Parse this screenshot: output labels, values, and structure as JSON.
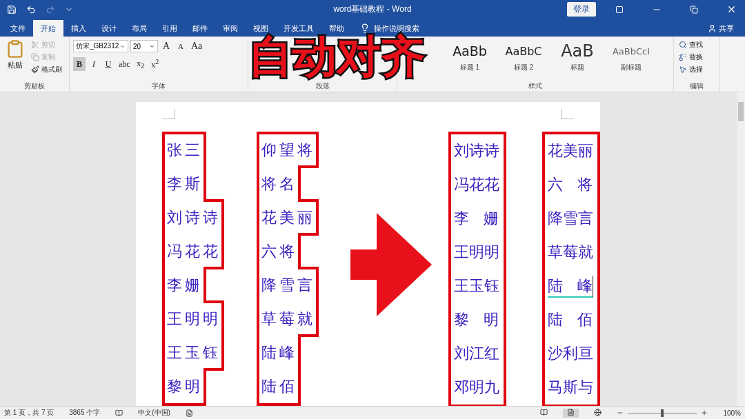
{
  "window": {
    "title": "word基础教程 - Word",
    "sign_in": "登录"
  },
  "tabs": [
    {
      "label": "文件",
      "selected": false
    },
    {
      "label": "开始",
      "selected": true
    },
    {
      "label": "插入",
      "selected": false
    },
    {
      "label": "设计",
      "selected": false
    },
    {
      "label": "布局",
      "selected": false
    },
    {
      "label": "引用",
      "selected": false
    },
    {
      "label": "邮件",
      "selected": false
    },
    {
      "label": "审阅",
      "selected": false
    },
    {
      "label": "视图",
      "selected": false
    },
    {
      "label": "开发工具",
      "selected": false
    },
    {
      "label": "帮助",
      "selected": false
    }
  ],
  "tell_me": "操作说明搜索",
  "share": "共享",
  "ribbon": {
    "clipboard": {
      "paste": "粘贴",
      "items": [
        {
          "label": "剪切",
          "disabled": true
        },
        {
          "label": "复制",
          "disabled": true
        },
        {
          "label": "格式刷",
          "disabled": false
        }
      ],
      "group": "剪贴板"
    },
    "font": {
      "name": "仿宋_GB2312",
      "size": "20",
      "row1": [
        "A",
        "A",
        "Aa"
      ],
      "row2": [
        "B",
        "I",
        "U",
        "abc",
        "x$_{2}$",
        "x$^{2}$"
      ],
      "group": "字体"
    },
    "paragraph": {
      "group": "段落"
    },
    "styles": {
      "items": [
        {
          "preview": "AaBb",
          "label": "标题 1"
        },
        {
          "preview": "AaBbC",
          "label": "标题 2"
        },
        {
          "preview": "AaB",
          "label": "标题"
        },
        {
          "preview": "AaBbCcI",
          "label": "副标题"
        }
      ],
      "group": "样式"
    },
    "editing": {
      "items": [
        "查找",
        "替换",
        "选择"
      ],
      "group": "编辑"
    }
  },
  "overlay_title": "自动对齐",
  "document": {
    "before": [
      {
        "names": [
          "张三",
          "李斯",
          "刘诗诗",
          "冯花花",
          "李姗",
          "王明明",
          "王玉钰",
          "黎明"
        ]
      },
      {
        "names": [
          "仰望将",
          "将名",
          "花美丽",
          "六将",
          "降雪言",
          "草莓就",
          "陆峰",
          "陆佰"
        ]
      }
    ],
    "after": [
      {
        "names": [
          {
            "text": "刘诗诗",
            "selected": false
          },
          {
            "text": "冯花花",
            "selected": false
          },
          {
            "text": "李姗",
            "selected": false
          },
          {
            "text": "王明明",
            "selected": false
          },
          {
            "text": "王玉钰",
            "selected": false
          },
          {
            "text": "黎明",
            "selected": false
          },
          {
            "text": "刘江红",
            "selected": false
          },
          {
            "text": "邓明九",
            "selected": false
          }
        ]
      },
      {
        "names": [
          {
            "text": "花美丽",
            "selected": false
          },
          {
            "text": "六将",
            "selected": false
          },
          {
            "text": "降雪言",
            "selected": false
          },
          {
            "text": "草莓就",
            "selected": false
          },
          {
            "text": "陆峰",
            "selected": true
          },
          {
            "text": "陆佰",
            "selected": false
          },
          {
            "text": "沙利亘",
            "selected": false
          },
          {
            "text": "马斯与",
            "selected": false
          }
        ]
      }
    ]
  },
  "status_bar": {
    "page": "第 1 页，共 7 页",
    "words": "3865 个字",
    "language": "中文(中国)",
    "zoom": {
      "level": 0.5,
      "reading": "100%"
    }
  }
}
